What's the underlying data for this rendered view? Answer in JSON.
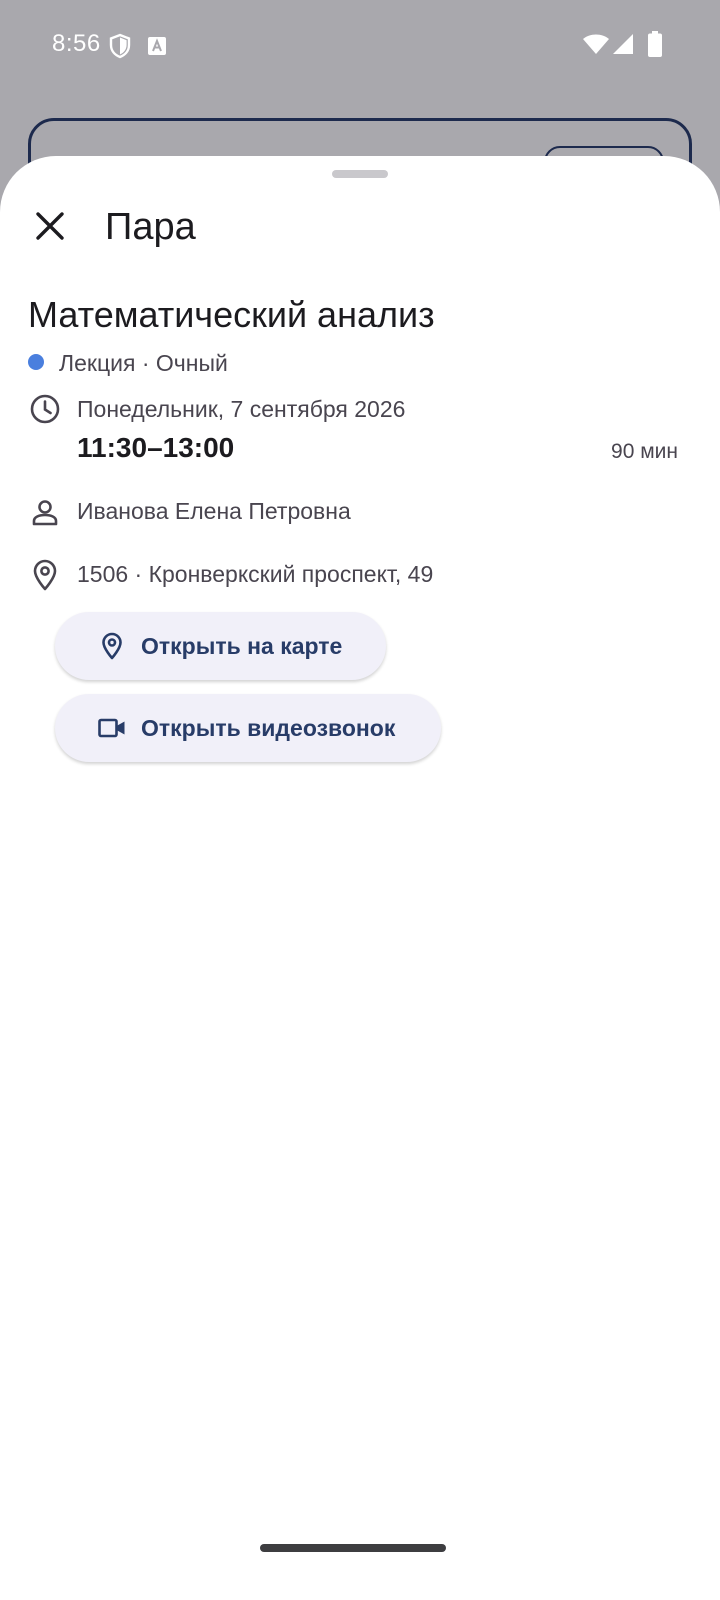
{
  "status_bar": {
    "time": "8:56",
    "icons": [
      "shield-icon",
      "a-icon",
      "wifi-icon",
      "signal-icon",
      "battery-icon"
    ]
  },
  "sheet": {
    "title": "Пара",
    "close_icon": "close-icon"
  },
  "lesson": {
    "course": "Математический анализ",
    "type_line": "Лекция · Очный",
    "type_color": "#4a7fde",
    "date": "Понедельник, 7 сентября 2026",
    "time": "11:30–13:00",
    "duration": "90 мин",
    "teacher": "Иванова Елена Петровна",
    "location": "1506 · Кронверкский проспект, 49"
  },
  "actions": {
    "open_map": "Открыть на карте",
    "open_video": "Открыть видеозвонок"
  },
  "colors": {
    "accent": "#283c68",
    "button_bg": "#f1f0f9",
    "scrim": "#a9a8ad"
  }
}
